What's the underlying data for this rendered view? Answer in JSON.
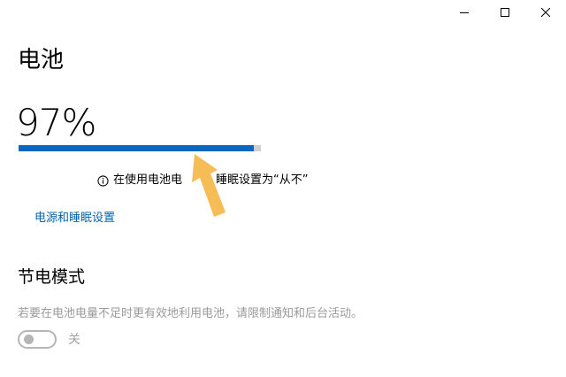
{
  "window": {
    "controls": {
      "minimize_icon": "minimize-icon",
      "maximize_icon": "maximize-icon",
      "close_icon": "close-icon"
    }
  },
  "page": {
    "title": "电池"
  },
  "battery": {
    "percent_text": "97%",
    "level": 0.97,
    "colors": {
      "fill": "#0a67c0",
      "track": "#cfcfcf"
    },
    "info": {
      "icon": "info-icon",
      "text_start": "在使用电池电",
      "text_end": "睡眠设置为“从不”"
    },
    "link_label": "电源和睡眠设置"
  },
  "battery_saver": {
    "title": "节电模式",
    "description": "若要在电池电量不足时更有效地利用电池，请限制通知和后台活动。",
    "toggle_state": "关"
  },
  "annotation": {
    "arrow_color": "#f5b84c",
    "icon": "pointer-arrow-icon"
  }
}
